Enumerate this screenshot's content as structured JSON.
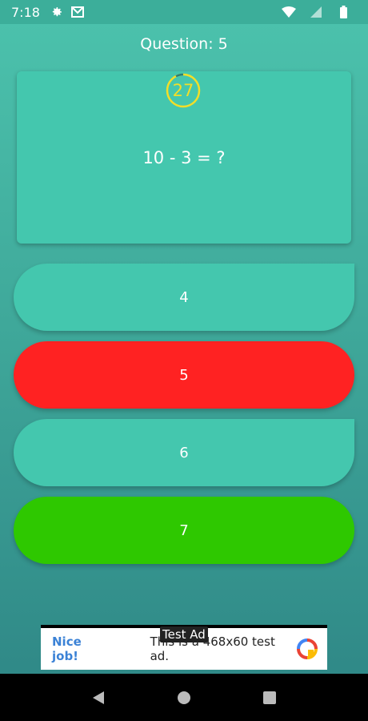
{
  "status_bar": {
    "time": "7:18",
    "icons": [
      "settings-icon",
      "mail-icon",
      "wifi-icon",
      "signal-icon",
      "battery-icon"
    ]
  },
  "quiz": {
    "question_title": "Question: 5",
    "timer_value": "27",
    "question_text": "10 - 3 = ?",
    "answers": [
      {
        "label": "4",
        "state": "default",
        "color": "#44c7ae"
      },
      {
        "label": "5",
        "state": "wrong",
        "color": "#ff2222"
      },
      {
        "label": "6",
        "state": "default",
        "color": "#44c7ae"
      },
      {
        "label": "7",
        "state": "correct",
        "color": "#2ec800"
      }
    ]
  },
  "ad": {
    "tag": "Test Ad",
    "headline": "Nice job!",
    "description": "This is a 468x60 test ad."
  },
  "nav": {
    "buttons": [
      "back-icon",
      "home-icon",
      "recents-icon"
    ]
  },
  "colors": {
    "timer": "#f2de28",
    "card": "#44c7ae",
    "wrong": "#ff2222",
    "correct": "#2ec800"
  }
}
